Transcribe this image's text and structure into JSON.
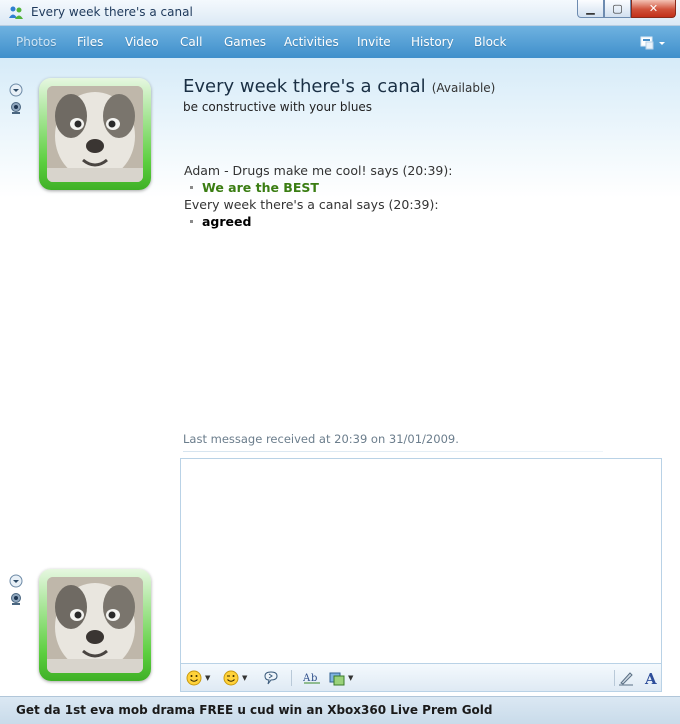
{
  "window": {
    "title": "Every week there's a canal",
    "minimize_icon": "minimize-icon",
    "maximize_icon": "maximize-icon",
    "close_icon": "close-icon"
  },
  "menu": {
    "items": [
      {
        "label": "Photos",
        "disabled": true
      },
      {
        "label": "Files"
      },
      {
        "label": "Video"
      },
      {
        "label": "Call"
      },
      {
        "label": "Games"
      },
      {
        "label": "Activities"
      },
      {
        "label": "Invite"
      },
      {
        "label": "History"
      },
      {
        "label": "Block"
      }
    ]
  },
  "contact": {
    "name": "Every week there's a canal",
    "status": "(Available)",
    "personal_message": "be constructive with your blues"
  },
  "conversation": [
    {
      "sender_line": "Adam - Drugs make me cool! says (20:39):",
      "message": "We are the BEST",
      "color": "#3a7d12"
    },
    {
      "sender_line": "Every week there's a canal says (20:39):",
      "message": "agreed",
      "color": "#000000"
    }
  ],
  "last_received": "Last message received at 20:39 on 31/01/2009.",
  "input": {
    "value": ""
  },
  "footer": {
    "ad_text": "Get da 1st eva mob drama FREE u cud win an Xbox360 Live Prem Gold"
  },
  "colors": {
    "menu_bar": "#4a9ad3",
    "avatar_frame": "#5ccf3f",
    "accent_green": "#3a7d12"
  }
}
